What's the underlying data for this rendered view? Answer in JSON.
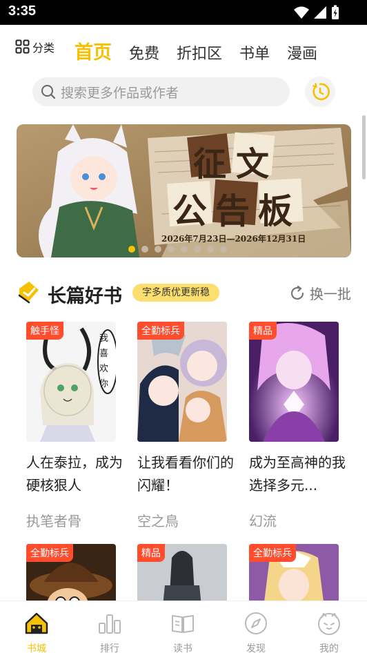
{
  "status_bar": {
    "time": "3:35"
  },
  "topnav": {
    "category_label": "分类",
    "tabs": [
      {
        "label": "首页",
        "active": true
      },
      {
        "label": "免费",
        "active": false
      },
      {
        "label": "折扣区",
        "active": false
      },
      {
        "label": "书单",
        "active": false
      },
      {
        "label": "漫画",
        "active": false
      }
    ]
  },
  "search": {
    "placeholder": "搜索更多作品或作者"
  },
  "banner": {
    "title_line1": "征文",
    "title_line2": "公告板",
    "date_range": "2026年7月23日—2026年12月31日",
    "dots_count": 8,
    "active_dot": 0
  },
  "section": {
    "title": "长篇好书",
    "tag": "字多质优更新稳",
    "refresh_label": "换一批"
  },
  "books": [
    {
      "badge": "触手怪",
      "title": "人在泰拉，成为硬核狠人",
      "author": "执笔者骨",
      "bubble": "我喜欢你"
    },
    {
      "badge": "全勤标兵",
      "title": "让我看看你们的闪耀！",
      "author": "空之鳥"
    },
    {
      "badge": "精品",
      "title": "成为至高神的我选择多元...",
      "author": "幻流"
    },
    {
      "badge": "全勤标兵"
    },
    {
      "badge": "精品"
    },
    {
      "badge": "全勤标兵"
    }
  ],
  "tabbar": {
    "items": [
      {
        "label": "书城",
        "active": true
      },
      {
        "label": "排行",
        "active": false
      },
      {
        "label": "读书",
        "active": false
      },
      {
        "label": "发现",
        "active": false
      },
      {
        "label": "我的",
        "active": false
      }
    ]
  },
  "colors": {
    "accent": "#f5c100",
    "badge": "#ff4d2e",
    "tag_bg": "#fcdf6e"
  }
}
